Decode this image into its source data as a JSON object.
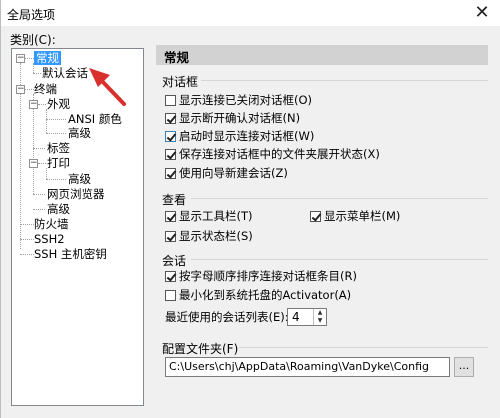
{
  "window": {
    "title": "全局选项",
    "close_glyph": "✕"
  },
  "category_label": "类别(C):",
  "tree": {
    "general": "常规",
    "default_session": "默认会话",
    "terminal": "终端",
    "appearance": "外观",
    "ansi_color": "ANSI 颜色",
    "advanced_1": "高级",
    "tabs": "标签",
    "print": "打印",
    "advanced_2": "高级",
    "web_browser": "网页浏览器",
    "advanced_3": "高级",
    "firewall": "防火墙",
    "ssh2": "SSH2",
    "ssh_host_keys": "SSH 主机密钥",
    "collapse_glyph": "−"
  },
  "panel": {
    "header": "常规",
    "dialog_group": {
      "title": "对话框",
      "items": [
        {
          "label": "显示连接已关闭对话框(O)",
          "checked": false
        },
        {
          "label": "显示断开确认对话框(N)",
          "checked": true
        },
        {
          "label": "启动时显示连接对话框(W)",
          "checked": true
        },
        {
          "label": "保存连接对话框中的文件夹展开状态(X)",
          "checked": true
        },
        {
          "label": "使用向导新建会话(Z)",
          "checked": true
        }
      ]
    },
    "view_group": {
      "title": "查看",
      "show_toolbar": {
        "label": "显示工具栏(T)",
        "checked": true
      },
      "show_menubar": {
        "label": "显示菜单栏(M)",
        "checked": true
      },
      "show_statusbar": {
        "label": "显示状态栏(S)",
        "checked": true
      }
    },
    "session_group": {
      "title": "会话",
      "sort_alpha": {
        "label": "按字母顺序排序连接对话框条目(R)",
        "checked": true
      },
      "minimize_tray": {
        "label": "最小化到系统托盘的Activator(A)",
        "checked": false
      },
      "recent_label": "最近使用的会话列表(E):",
      "recent_value": "4",
      "spin_up": "▲",
      "spin_down": "▼"
    },
    "config_folder": {
      "title": "配置文件夹(F)",
      "path": "C:\\Users\\chj\\AppData\\Roaming\\VanDyke\\Config",
      "browse_label": "..."
    }
  },
  "colors": {
    "selection": "#3399ff",
    "annotation_arrow": "#d9302c",
    "header_bg": "#d2d2d2"
  }
}
